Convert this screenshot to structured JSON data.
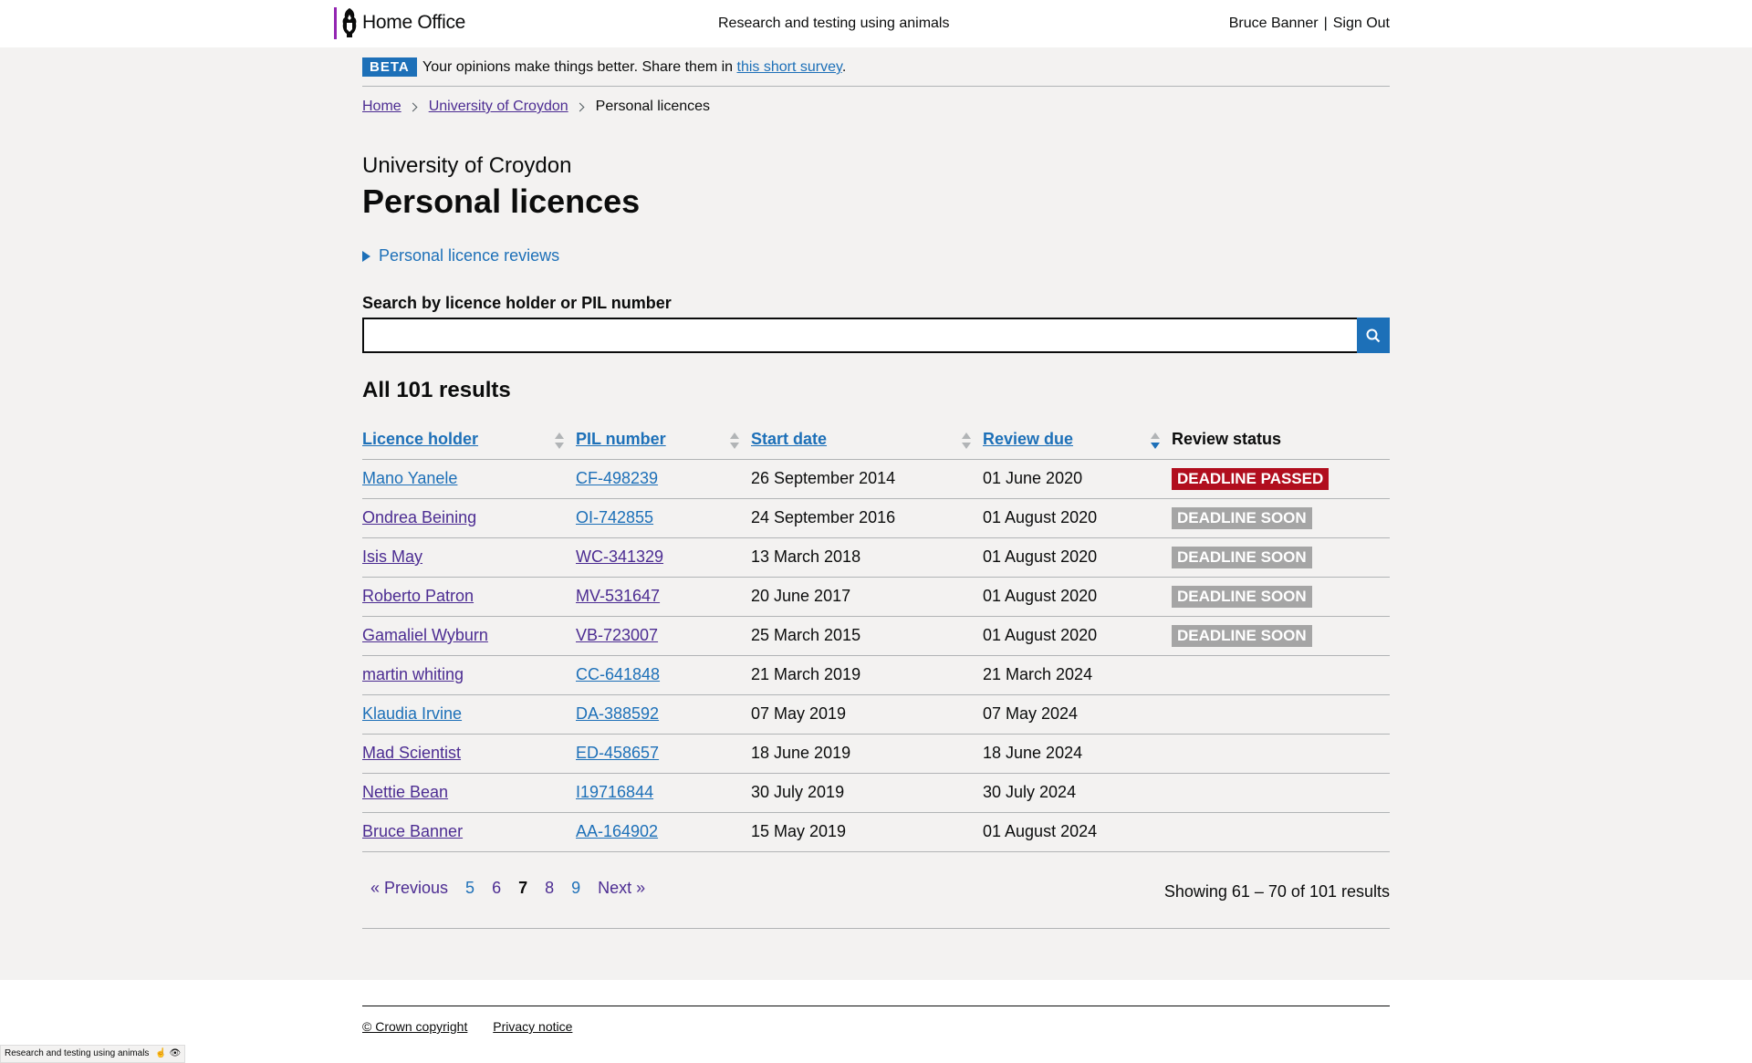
{
  "header": {
    "logo_text": "Home Office",
    "service_name": "Research and testing using animals",
    "user_name": "Bruce Banner",
    "separator": "|",
    "sign_out": "Sign Out"
  },
  "beta": {
    "tag": "BETA",
    "text": "Your opinions make things better. Share them in ",
    "link": "this short survey",
    "suffix": "."
  },
  "breadcrumbs": {
    "home": "Home",
    "establishment": "University of Croydon",
    "current": "Personal licences"
  },
  "page": {
    "caption": "University of Croydon",
    "title": "Personal licences",
    "details_summary": "Personal licence reviews",
    "search_label": "Search by licence holder or PIL number",
    "search_value": "",
    "results_heading": "All 101 results"
  },
  "table": {
    "headers": {
      "licence_holder": "Licence holder",
      "pil_number": "PIL number",
      "start_date": "Start date",
      "review_due": "Review due",
      "review_status": "Review status"
    },
    "rows": [
      {
        "holder": "Mano Yanele",
        "pil": "CF-498239",
        "start": "26 September 2014",
        "due": "01 June 2020",
        "status": "DEADLINE PASSED"
      },
      {
        "holder": "Ondrea Beining",
        "pil": "OI-742855",
        "start": "24 September 2016",
        "due": "01 August 2020",
        "status": "DEADLINE SOON"
      },
      {
        "holder": "Isis May",
        "pil": "WC-341329",
        "start": "13 March 2018",
        "due": "01 August 2020",
        "status": "DEADLINE SOON"
      },
      {
        "holder": "Roberto Patron",
        "pil": "MV-531647",
        "start": "20 June 2017",
        "due": "01 August 2020",
        "status": "DEADLINE SOON"
      },
      {
        "holder": "Gamaliel Wyburn",
        "pil": "VB-723007",
        "start": "25 March 2015",
        "due": "01 August 2020",
        "status": "DEADLINE SOON"
      },
      {
        "holder": "martin whiting",
        "pil": "CC-641848",
        "start": "21 March 2019",
        "due": "21 March 2024",
        "status": ""
      },
      {
        "holder": "Klaudia Irvine",
        "pil": "DA-388592",
        "start": "07 May 2019",
        "due": "07 May 2024",
        "status": ""
      },
      {
        "holder": "Mad Scientist",
        "pil": "ED-458657",
        "start": "18 June 2019",
        "due": "18 June 2024",
        "status": ""
      },
      {
        "holder": "Nettie Bean",
        "pil": "I19716844",
        "start": "30 July 2019",
        "due": "30 July 2024",
        "status": ""
      },
      {
        "holder": "Bruce Banner",
        "pil": "AA-164902",
        "start": "15 May 2019",
        "due": "01 August 2024",
        "status": ""
      }
    ]
  },
  "pagination": {
    "previous": "« Previous",
    "pages": [
      "5",
      "6",
      "7",
      "8",
      "9"
    ],
    "current": "7",
    "next": "Next »",
    "showing": "Showing 61 – 70 of 101 results"
  },
  "footer": {
    "copyright": "© Crown copyright",
    "privacy": "Privacy notice"
  },
  "env_bar": {
    "text": "Research and testing using animals"
  },
  "colors": {
    "link": "#1d70b8",
    "visited": "#4c2c92",
    "deadline_passed": "#b10e1e",
    "deadline_soon": "#a5a5a5",
    "crest_bar": "#9325b2"
  }
}
